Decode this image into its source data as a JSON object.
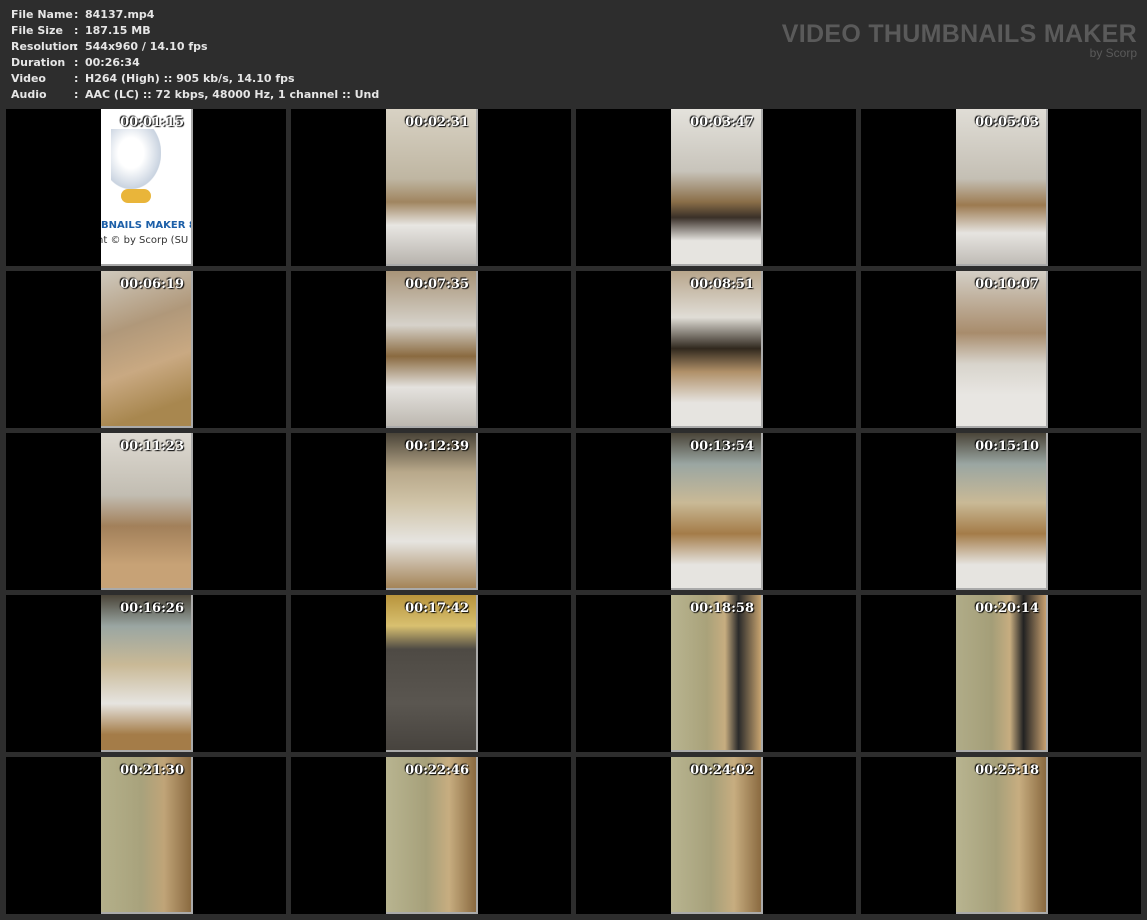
{
  "info": [
    {
      "key": "File Name",
      "value": "84137.mp4"
    },
    {
      "key": "File Size",
      "value": "187.15 MB"
    },
    {
      "key": "Resolution",
      "value": "544x960 / 14.10 fps"
    },
    {
      "key": "Duration",
      "value": "00:26:34"
    },
    {
      "key": "Video",
      "value": "H264 (High) :: 905 kb/s, 14.10 fps"
    },
    {
      "key": "Audio",
      "value": "AAC (LC) :: 72 kbps, 48000 Hz, 1 channel :: Und"
    }
  ],
  "brand": {
    "title": "VIDEO THUMBNAILS MAKER",
    "subtitle": "by Scorp"
  },
  "first_thumb": {
    "logo_text": "MBNAILS MAKER 8",
    "copyright": "nt © by Scorp (SU"
  },
  "thumbnails": [
    "00:01:15",
    "00:02:31",
    "00:03:47",
    "00:05:03",
    "00:06:19",
    "00:07:35",
    "00:08:51",
    "00:10:07",
    "00:11:23",
    "00:12:39",
    "00:13:54",
    "00:15:10",
    "00:16:26",
    "00:17:42",
    "00:18:58",
    "00:20:14",
    "00:21:30",
    "00:22:46",
    "00:24:02",
    "00:25:18"
  ]
}
